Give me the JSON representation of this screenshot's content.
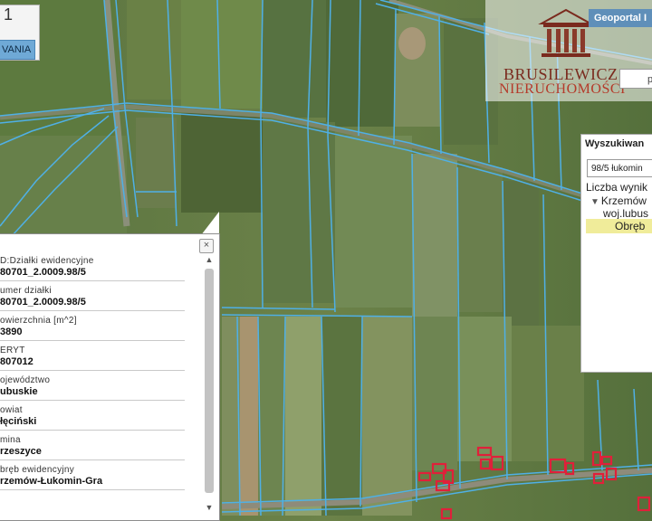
{
  "top_left": {
    "digit": "1",
    "button_label": "VANIA"
  },
  "logo": {
    "portal_label": "Geoportal I",
    "name_line1": "BRUSILEWICZ",
    "name_line2": "NIERUCHOMOŚCI",
    "search_stub_text": "p"
  },
  "search_panel": {
    "heading": "Wyszukiwan",
    "input_value": "98/5 łukomin",
    "result_count_label": "Liczba wynik",
    "tree_item": "Krzemów",
    "tree_sub": "woj.lubus",
    "highlighted_item": "Obręb"
  },
  "popup": {
    "close_glyph": "×",
    "scroll_up": "▲",
    "scroll_down": "▼",
    "rows": [
      {
        "label": "D:Działki ewidencyjne",
        "value": "80701_2.0009.98/5"
      },
      {
        "label": "umer działki",
        "value": "80701_2.0009.98/5"
      },
      {
        "label": "owierzchnia [m^2]",
        "value": "3890"
      },
      {
        "label": "ERYT",
        "value": "807012"
      },
      {
        "label": "ojewództwo",
        "value": "ubuskie"
      },
      {
        "label": "owiat",
        "value": "łęciński"
      },
      {
        "label": "mina",
        "value": "rzeszyce"
      },
      {
        "label": "bręb ewidencyjny",
        "value": "rzemów-Łukomin-Gra"
      }
    ]
  },
  "colors": {
    "field_dark": "#4e6a3a",
    "field_light": "#7f9160",
    "parcel_line": "#4fb0e6",
    "building": "#e0203a",
    "highlight": "#f0ec9a"
  }
}
